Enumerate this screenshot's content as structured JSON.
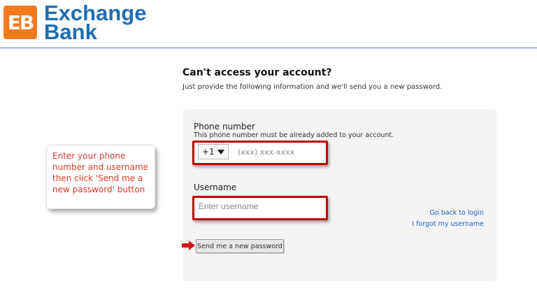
{
  "brand": {
    "badge": "EB",
    "name_line1": "Exchange",
    "name_line2": "Bank",
    "color": "#1f6db3",
    "badge_color": "#f47a20"
  },
  "page": {
    "title": "Can't access your account?",
    "subtitle": "Just provide the following information and we'll send you a new password."
  },
  "form": {
    "phone_label": "Phone number",
    "phone_hint": "This phone number must be already added to your account.",
    "country_code": "+1",
    "phone_placeholder": "(xxx) xxx-xxxx",
    "username_label": "Username",
    "username_placeholder": "Enter username",
    "submit_label": "Send me a new password"
  },
  "links": {
    "back_to_login": "Go back to login",
    "forgot_username": "I forgot my username"
  },
  "callout": {
    "text": "Enter your phone number and username then click 'Send me a new password' button"
  },
  "colors": {
    "highlight": "#c00000",
    "link": "#1f5fbf",
    "callout_text": "#e03a2a"
  }
}
